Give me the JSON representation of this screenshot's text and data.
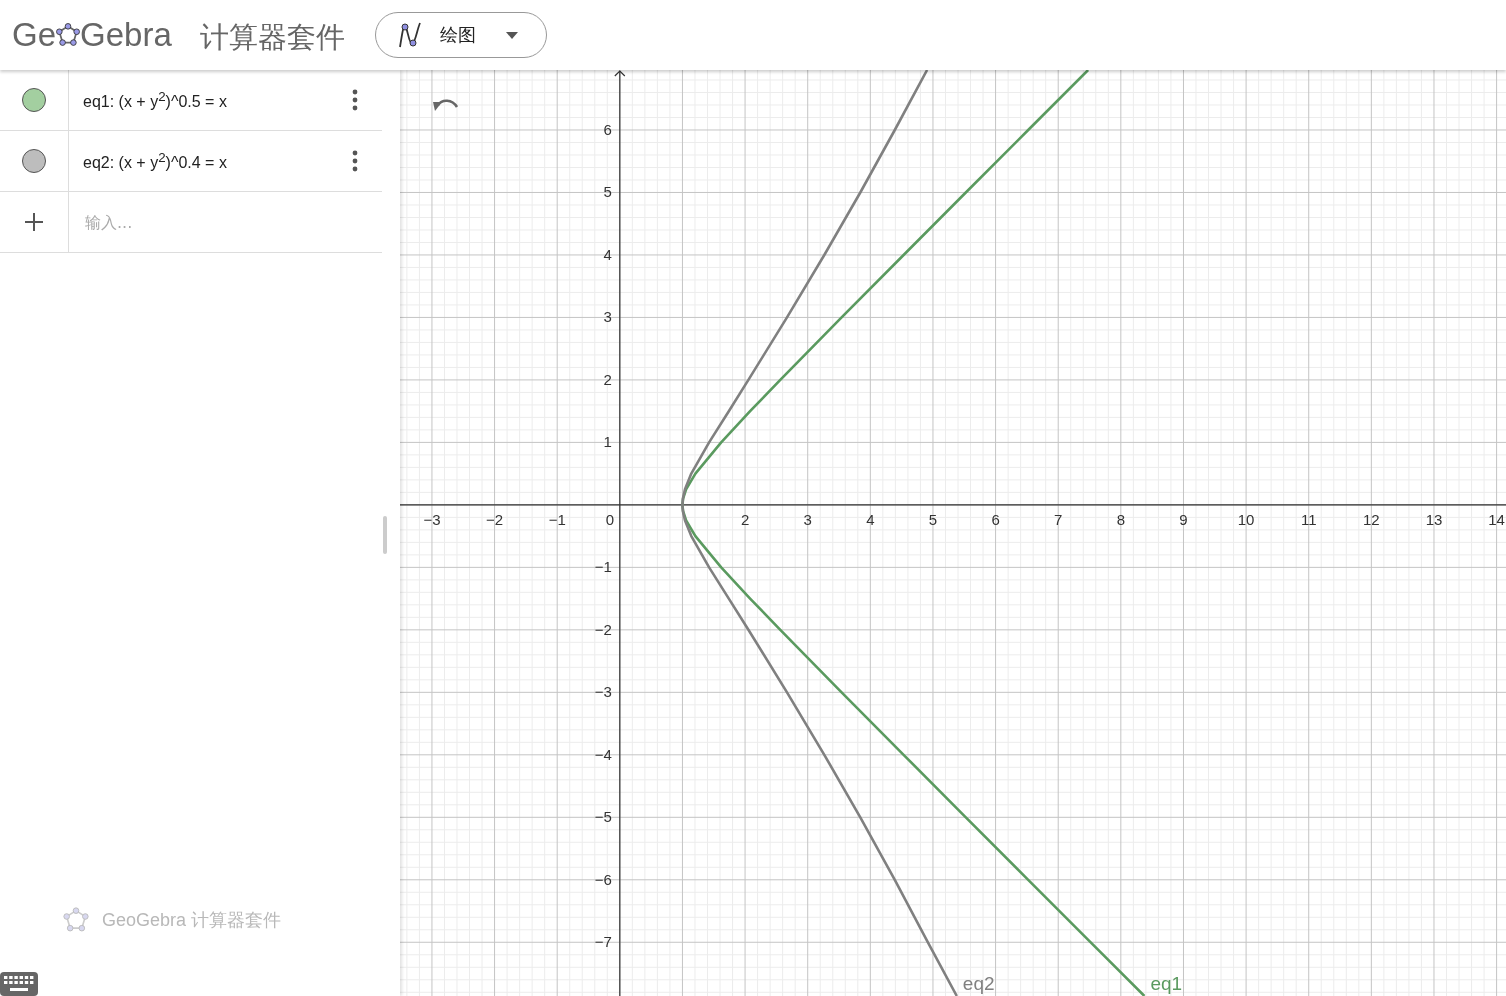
{
  "header": {
    "logo": [
      "Ge",
      "Gebra"
    ],
    "title": "计算器套件",
    "mode_menu": {
      "label": "绘图"
    }
  },
  "algebra": {
    "items": [
      {
        "formula": "eq1: (x + y$^{2}$)^0.5 = x",
        "color": "#a3cfa0"
      },
      {
        "formula": "eq2: (x + y$^{2}$)^0.4 = x",
        "color": "#bdbdbd"
      }
    ],
    "input": {
      "placeholder": "输入..."
    },
    "footer": "GeoGebra 计算器套件"
  },
  "graphics": {
    "chart_data": {
      "type": "line",
      "grid": true,
      "xlim": [
        -3.51,
        14.15
      ],
      "ylim": [
        -7.86,
        6.96
      ],
      "xticks": [
        {
          "value": -3,
          "label": "−3"
        },
        {
          "value": -2,
          "label": "−2"
        },
        {
          "value": -1,
          "label": "−1"
        },
        {
          "value": 0,
          "label": "0"
        },
        {
          "value": 2,
          "label": "2"
        },
        {
          "value": 3,
          "label": "3"
        },
        {
          "value": 4,
          "label": "4"
        },
        {
          "value": 5,
          "label": "5"
        },
        {
          "value": 6,
          "label": "6"
        },
        {
          "value": 7,
          "label": "7"
        },
        {
          "value": 8,
          "label": "8"
        },
        {
          "value": 9,
          "label": "9"
        },
        {
          "value": 10,
          "label": "10"
        },
        {
          "value": 11,
          "label": "11"
        },
        {
          "value": 12,
          "label": "12"
        },
        {
          "value": 13,
          "label": "13"
        },
        {
          "value": 14,
          "label": "14"
        }
      ],
      "yticks": [
        {
          "value": -7,
          "label": "−7"
        },
        {
          "value": -6,
          "label": "−6"
        },
        {
          "value": -5,
          "label": "−5"
        },
        {
          "value": -4,
          "label": "−4"
        },
        {
          "value": -3,
          "label": "−3"
        },
        {
          "value": -2,
          "label": "−2"
        },
        {
          "value": -1,
          "label": "−1"
        },
        {
          "value": 1,
          "label": "1"
        },
        {
          "value": 2,
          "label": "2"
        },
        {
          "value": 3,
          "label": "3"
        },
        {
          "value": 4,
          "label": "4"
        },
        {
          "value": 5,
          "label": "5"
        },
        {
          "value": 6,
          "label": "6"
        }
      ],
      "series": [
        {
          "name": "eq1",
          "color": "#5a9a5f",
          "x": [
            8.376,
            7.518,
            6.521,
            5.525,
            4.531,
            3.541,
            2.562,
            2.081,
            1.618,
            1.207,
            1.059,
            1.01,
            1,
            1.01,
            1.059,
            1.207,
            1.618,
            2.081,
            2.562,
            3.541,
            4.531,
            5.525,
            6.521,
            7.478
          ],
          "values": [
            -7.86,
            -7,
            -6,
            -5,
            -4,
            -3,
            -2,
            -1.5,
            -1,
            -0.5,
            -0.25,
            -0.1,
            0,
            0.1,
            0.25,
            0.5,
            1,
            1.5,
            2,
            3,
            4,
            5,
            6,
            6.96
          ]
        },
        {
          "name": "eq2",
          "color": "#808080",
          "x": [
            5.381,
            4.92,
            4.39,
            3.84,
            3.265,
            2.67,
            2.053,
            1.74,
            1.425,
            1.141,
            1.04,
            1.0067,
            1,
            1.0067,
            1.04,
            1.141,
            1.425,
            1.74,
            2.053,
            2.67,
            3.265,
            3.84,
            4.39,
            4.907
          ],
          "values": [
            -7.86,
            -7,
            -6,
            -5,
            -4,
            -3,
            -2,
            -1.5,
            -1,
            -0.5,
            -0.25,
            -0.1,
            0,
            0.1,
            0.25,
            0.5,
            1,
            1.5,
            2,
            3,
            4,
            5,
            6,
            6.96
          ]
        }
      ]
    }
  }
}
